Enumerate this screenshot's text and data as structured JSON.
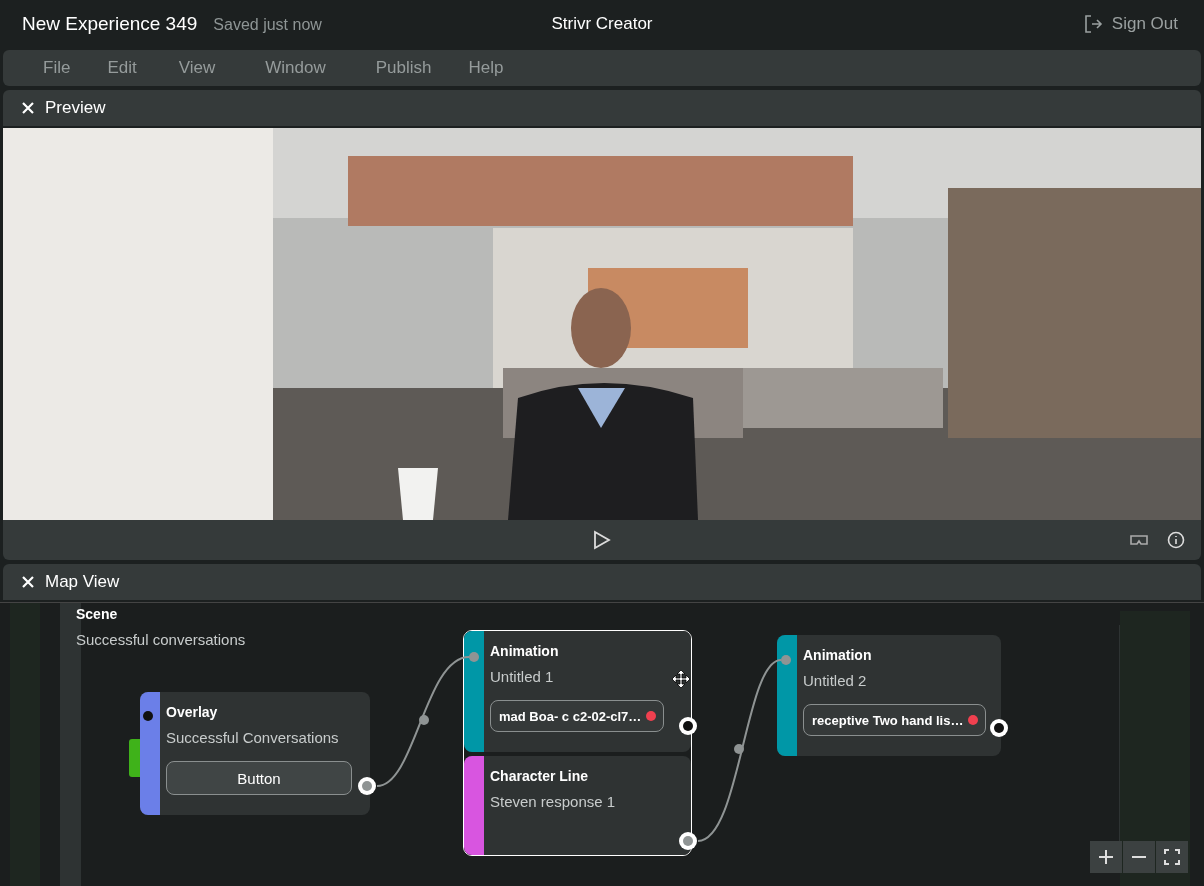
{
  "header": {
    "title": "New Experience 349",
    "save_status": "Saved just now",
    "app_name": "Strivr Creator",
    "sign_out": "Sign Out"
  },
  "menu": [
    "File",
    "Edit",
    "View",
    "Window",
    "Publish",
    "Help"
  ],
  "preview": {
    "title": "Preview"
  },
  "map_view": {
    "title": "Map View",
    "scene_label": "Scene",
    "scene_name": "Successful conversations",
    "blocks": [
      {
        "selected": false,
        "sections": [
          {
            "kind": "overlay",
            "type": "Overlay",
            "name": "Successful Conversations",
            "button": "Button",
            "color": "#6b7fe8"
          }
        ]
      },
      {
        "selected": true,
        "sections": [
          {
            "kind": "animation",
            "type": "Animation",
            "name": "Untitled 1",
            "chip": "mad Boa- c c2-02-cl7…",
            "error": true,
            "color": "#0097a7"
          },
          {
            "kind": "character_line",
            "type": "Character Line",
            "name": "Steven response 1",
            "color": "#d855e0"
          }
        ]
      },
      {
        "selected": false,
        "sections": [
          {
            "kind": "animation",
            "type": "Animation",
            "name": "Untitled 2",
            "chip": "receptive Two hand lis…",
            "error": true,
            "color": "#0097a7"
          }
        ]
      }
    ]
  }
}
